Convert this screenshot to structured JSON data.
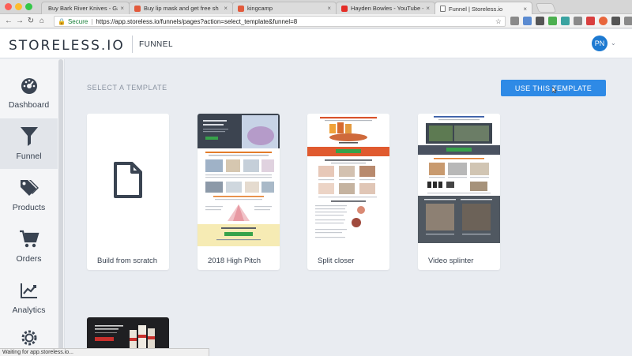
{
  "browser": {
    "tabs": [
      {
        "title": "Buy Bark River Knives - Game",
        "favicon": "none",
        "active": false
      },
      {
        "title": "Buy lip mask and get free sh",
        "favicon": "tick",
        "active": false
      },
      {
        "title": "kingcamp",
        "favicon": "tick",
        "active": false
      },
      {
        "title": "Hayden Bowles - YouTube - Y",
        "favicon": "youtube",
        "active": false
      },
      {
        "title": "Funnel | Storeless.io",
        "favicon": "document",
        "active": true
      }
    ],
    "tab_close": "×",
    "address": {
      "secure_label": "Secure",
      "separator": "|",
      "url": "https://app.storeless.io/funnels/pages?action=select_template&funnel=8"
    },
    "status_text": "Waiting for app.storeless.io..."
  },
  "header": {
    "logo": "STORELESS.IO",
    "section": "FUNNEL",
    "avatar_initials": "PN"
  },
  "sidebar": {
    "items": [
      {
        "label": "Dashboard",
        "icon": "dashboard-gauge-icon",
        "active": false
      },
      {
        "label": "Funnel",
        "icon": "funnel-icon",
        "active": true
      },
      {
        "label": "Products",
        "icon": "tags-icon",
        "active": false
      },
      {
        "label": "Orders",
        "icon": "cart-icon",
        "active": false
      },
      {
        "label": "Analytics",
        "icon": "line-chart-icon",
        "active": false
      },
      {
        "label": "",
        "icon": "gear-icon",
        "active": false
      }
    ]
  },
  "main": {
    "heading": "SELECT A TEMPLATE",
    "use_button": "USE THIS TEMPLATE",
    "templates": [
      {
        "label": "Build from scratch",
        "thumb": "document-icon"
      },
      {
        "label": "2018 High Pitch",
        "thumb": "preview"
      },
      {
        "label": "Split closer",
        "thumb": "preview"
      },
      {
        "label": "Video splinter",
        "thumb": "preview"
      },
      {
        "label": "",
        "thumb": "preview"
      }
    ]
  },
  "colors": {
    "accent": "#2e8ae6",
    "avatar": "#1e7ad1",
    "page_bg": "#e9ecf1",
    "sidebar_bg": "#f4f5f7"
  }
}
